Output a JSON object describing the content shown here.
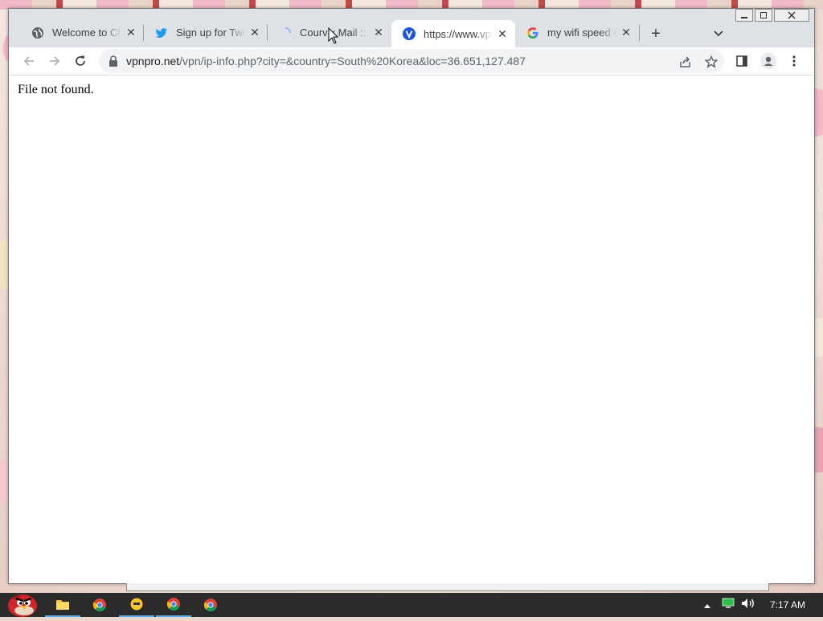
{
  "window": {
    "tabs": [
      {
        "title": "Welcome to Chrome",
        "icon": "globe-icon",
        "active": false
      },
      {
        "title": "Sign up for Twitter",
        "icon": "twitter-icon",
        "active": false
      },
      {
        "title": "Courvix Mail :: Inbox",
        "icon": "loading-spinner-icon",
        "active": false
      },
      {
        "title": "https://www.vpnpro.net",
        "icon": "vpnpro-icon",
        "active": true
      },
      {
        "title": "my wifi speed right now",
        "icon": "google-icon",
        "active": false
      }
    ],
    "new_tab_symbol": "+",
    "close_symbol": "✕"
  },
  "toolbar": {
    "url_domain": "vpnpro.net",
    "url_path": "/vpn/ip-info.php?city=&country=South%20Korea&loc=36.651,127.487"
  },
  "page": {
    "message": "File not found."
  },
  "taskbar": {
    "apps": [
      "angry-birds-start-icon",
      "file-explorer-icon",
      "chrome-icon",
      "emoji-app-icon",
      "chrome-icon",
      "chrome-icon"
    ],
    "clock": "7:17 AM"
  },
  "colors": {
    "tabstrip_bg": "#dee1e6",
    "omnibox_bg": "#f1f3f4",
    "taskbar_bg": "#2b2b2b",
    "twitter_blue": "#1d9bf0",
    "vpnpro_blue": "#1a56db"
  }
}
